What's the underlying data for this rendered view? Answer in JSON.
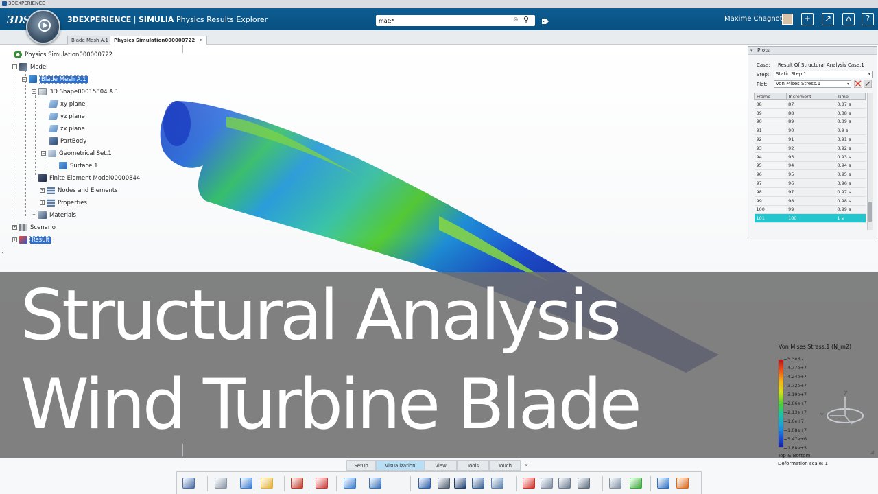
{
  "window": {
    "title": "3DEXPERIENCE"
  },
  "topbar": {
    "logo": "3DS",
    "brand": "3DEXPERIENCE",
    "separator": " | ",
    "product": "SIMULIA",
    "app": "Physics Results Explorer",
    "search_value": "mat:*",
    "user_name": "Maxime Chagnot",
    "accent_color": "#0b5788"
  },
  "tabs": [
    {
      "label": "Blade Mesh A.1",
      "active": false
    },
    {
      "label": "Physics Simulation000000722",
      "active": true
    }
  ],
  "tree": {
    "root": "Physics Simulation000000722",
    "model": "Model",
    "blade_mesh": "Blade Mesh A.1",
    "shape": "3D Shape00015804 A.1",
    "xy_plane": "xy plane",
    "yz_plane": "yz plane",
    "zx_plane": "zx plane",
    "partbody": "PartBody",
    "geoset": "Geometrical Set.1",
    "surface": "Surface.1",
    "fem": "Finite Element Model00000844",
    "nodes": "Nodes and Elements",
    "properties": "Properties",
    "materials": "Materials",
    "scenario": "Scenario",
    "result": "Result"
  },
  "plots": {
    "header": "Plots",
    "case_label": "Case:",
    "case_value": "Result Of Structural Analysis Case.1",
    "step_label": "Step:",
    "step_value": "Static Step.1",
    "plot_label": "Plot:",
    "plot_value": "Von Mises Stress.1",
    "columns": [
      "Frame",
      "Increment",
      "Time"
    ],
    "rows": [
      [
        "88",
        "87",
        "0.87 s"
      ],
      [
        "89",
        "88",
        "0.88 s"
      ],
      [
        "90",
        "89",
        "0.89 s"
      ],
      [
        "91",
        "90",
        "0.9 s"
      ],
      [
        "92",
        "91",
        "0.91 s"
      ],
      [
        "93",
        "92",
        "0.92 s"
      ],
      [
        "94",
        "93",
        "0.93 s"
      ],
      [
        "95",
        "94",
        "0.94 s"
      ],
      [
        "96",
        "95",
        "0.95 s"
      ],
      [
        "97",
        "96",
        "0.96 s"
      ],
      [
        "98",
        "97",
        "0.97 s"
      ],
      [
        "99",
        "98",
        "0.98 s"
      ],
      [
        "100",
        "99",
        "0.99 s"
      ],
      [
        "101",
        "100",
        "1 s"
      ]
    ],
    "selected_row": 13,
    "highlight_color": "#24c5cc"
  },
  "banner": {
    "line1": "Structural Analysis",
    "line2": "Wind Turbine Blade"
  },
  "legend": {
    "title": "Von Mises Stress.1 (N_m2)",
    "labels": [
      "5.3e+7",
      "4.77e+7",
      "4.24e+7",
      "3.72e+7",
      "3.19e+7",
      "2.66e+7",
      "2.13e+7",
      "1.6e+7",
      "1.08e+7",
      "5.47e+6",
      "1.88e+5"
    ],
    "footer1": "Top & Bottom",
    "footer2": "Deformation scale: 1"
  },
  "axis": {
    "z": "Z",
    "y": "Y"
  },
  "bottom_tabs": [
    {
      "label": "Setup",
      "active": false
    },
    {
      "label": "Visualization",
      "active": true
    },
    {
      "label": "View",
      "active": false
    },
    {
      "label": "Tools",
      "active": false
    },
    {
      "label": "Touch",
      "active": false
    }
  ],
  "toolbar_icons": [
    "undo-icon",
    "part-icon",
    "import-icon",
    "plot-icon",
    "display-icon",
    "alert-icon",
    "chart-bar-icon",
    "chart-line-icon",
    "deform-icon",
    "probe-icon",
    "axis-icon",
    "animation-icon",
    "sensor-icon",
    "color-legend-icon",
    "cube-icon",
    "grid-icon",
    "layout-icon",
    "report-icon",
    "pen-icon",
    "capture-icon",
    "settings-icon"
  ]
}
